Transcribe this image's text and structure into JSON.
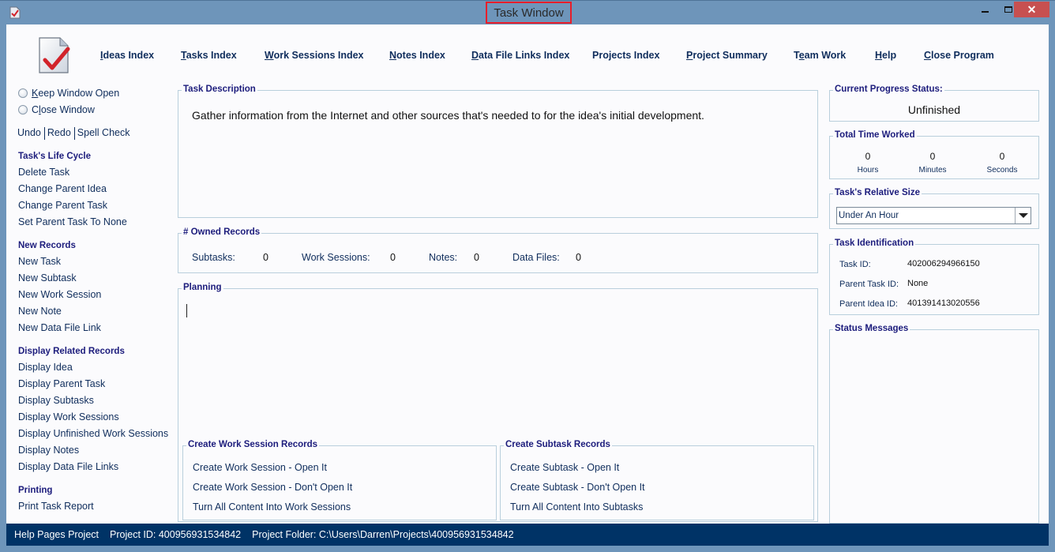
{
  "window": {
    "title": "Task Window",
    "icons": {
      "app": "task-check-icon",
      "minimize": "minimize-icon",
      "maximize": "maximize-icon",
      "close": "close-icon"
    },
    "close_glyph": "✕",
    "highlight_color": "#e81e2a"
  },
  "nav": {
    "logo_icon": "task-document-check-icon",
    "items": [
      {
        "label": "Ideas Index",
        "mnemonic": "I",
        "rest": "deas Index"
      },
      {
        "label": "Tasks Index",
        "mnemonic": "T",
        "rest": "asks Index"
      },
      {
        "label": "Work Sessions Index",
        "mnemonic": "W",
        "rest": "ork Sessions Index"
      },
      {
        "label": "Notes Index",
        "mnemonic": "N",
        "rest": "otes Index"
      },
      {
        "label": "Data File Links Index",
        "mnemonic": "D",
        "rest": "ata File Links Index"
      },
      {
        "label": "Projects Index",
        "mnemonic": "",
        "rest": "Projects Index"
      },
      {
        "label": "Project Summary",
        "mnemonic": "P",
        "rest": "roject Summary"
      },
      {
        "label": "Team Work",
        "pre": "T",
        "mnemonic": "e",
        "rest": "am Work"
      },
      {
        "label": "Help",
        "mnemonic": "H",
        "rest": "elp"
      },
      {
        "label": "Close Program",
        "mnemonic": "C",
        "rest": "lose Program"
      }
    ]
  },
  "sidebar": {
    "window_options": [
      {
        "label": "Keep Window Open",
        "pre": "",
        "mnemonic": "K",
        "rest": "eep Window Open",
        "selected": false
      },
      {
        "label": "Close Window",
        "pre": "C",
        "mnemonic": "l",
        "rest": "ose Window",
        "selected": false
      }
    ],
    "edit_actions": [
      "Undo",
      "Redo",
      "Spell Check"
    ],
    "sections": [
      {
        "heading": "Task's Life Cycle",
        "items": [
          "Delete Task",
          "Change Parent Idea",
          "Change Parent Task",
          "Set Parent Task To None"
        ]
      },
      {
        "heading": "New Records",
        "items": [
          "New Task",
          "New Subtask",
          "New Work Session",
          "New Note",
          "New Data File Link"
        ]
      },
      {
        "heading": "Display Related Records",
        "items": [
          "Display Idea",
          "Display Parent Task",
          "Display Subtasks",
          "Display Work Sessions",
          "Display Unfinished Work Sessions",
          "Display Notes",
          "Display Data File Links"
        ]
      },
      {
        "heading": "Printing",
        "items": [
          "Print Task Report"
        ]
      }
    ]
  },
  "main": {
    "description": {
      "title": "Task Description",
      "text": "Gather information from the Internet and other sources that's needed to for the idea's initial development."
    },
    "owned_records": {
      "title": "# Owned Records",
      "items": [
        {
          "label": "Subtasks:",
          "value": "0"
        },
        {
          "label": "Work Sessions:",
          "value": "0"
        },
        {
          "label": "Notes:",
          "value": "0"
        },
        {
          "label": "Data Files:",
          "value": "0"
        }
      ]
    },
    "planning": {
      "title": "Planning",
      "text": ""
    },
    "work_session_records": {
      "title": "Create Work Session Records",
      "actions": [
        "Create Work Session - Open It",
        "Create Work Session - Don't Open It",
        "Turn All Content Into Work Sessions"
      ]
    },
    "subtask_records": {
      "title": "Create Subtask Records",
      "actions": [
        "Create Subtask - Open It",
        "Create Subtask - Don't Open It",
        "Turn All Content Into Subtasks"
      ]
    }
  },
  "right": {
    "progress": {
      "title": "Current Progress Status:",
      "value": "Unfinished"
    },
    "time_worked": {
      "title": "Total Time Worked",
      "units": [
        {
          "value": "0",
          "label": "Hours"
        },
        {
          "value": "0",
          "label": "Minutes"
        },
        {
          "value": "0",
          "label": "Seconds"
        }
      ]
    },
    "relative_size": {
      "title": "Task's Relative Size",
      "selected": "Under An Hour",
      "icon": "dropdown-arrow-icon"
    },
    "identification": {
      "title": "Task Identification",
      "rows": [
        {
          "label": "Task ID:",
          "value": "402006294966150"
        },
        {
          "label": "Parent Task ID:",
          "value": "None"
        },
        {
          "label": "Parent Idea ID:",
          "value": "401391413020556"
        }
      ]
    },
    "status_messages": {
      "title": "Status Messages",
      "text": ""
    }
  },
  "statusbar": {
    "project_name": "Help Pages Project",
    "project_id": "Project ID:  400956931534842",
    "project_folder": "Project Folder: C:\\Users\\Darren\\Projects\\400956931534842"
  }
}
